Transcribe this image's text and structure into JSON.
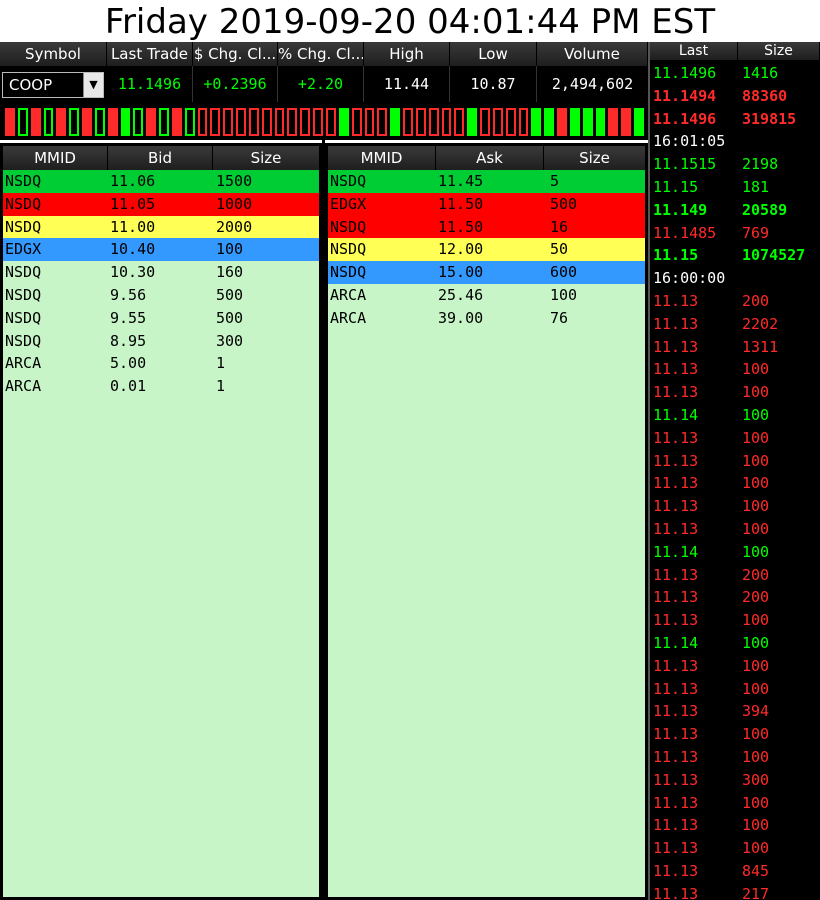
{
  "title": "Friday 2019-09-20 04:01:44 PM EST",
  "colors": {
    "up": "#00ff00",
    "down": "#ff2a2a",
    "level1": "#00cc33",
    "level2": "#ff0000",
    "level3": "#ffff55",
    "level4": "#3399ff",
    "book_bg": "#c8f5c8"
  },
  "quote": {
    "headers": [
      "Symbol",
      "Last Trade",
      "$ Chg. Cl...",
      "% Chg. Cl...",
      "High",
      "Low",
      "Volume"
    ],
    "symbol": "COOP",
    "last_trade": "11.1496",
    "chg": "+0.2396",
    "pct_chg": "+2.20",
    "high": "11.44",
    "low": "10.87",
    "volume": "2,494,602"
  },
  "ticks": [
    {
      "color": "red",
      "filled": true
    },
    {
      "color": "green",
      "filled": false
    },
    {
      "color": "red",
      "filled": true
    },
    {
      "color": "green",
      "filled": false
    },
    {
      "color": "red",
      "filled": true
    },
    {
      "color": "green",
      "filled": false
    },
    {
      "color": "red",
      "filled": true
    },
    {
      "color": "green",
      "filled": false
    },
    {
      "color": "red",
      "filled": true
    },
    {
      "color": "green",
      "filled": true
    },
    {
      "color": "green",
      "filled": false
    },
    {
      "color": "red",
      "filled": true
    },
    {
      "color": "green",
      "filled": false
    },
    {
      "color": "red",
      "filled": true
    },
    {
      "color": "green",
      "filled": false
    },
    {
      "color": "red",
      "filled": false
    },
    {
      "color": "red",
      "filled": false
    },
    {
      "color": "red",
      "filled": false
    },
    {
      "color": "red",
      "filled": false
    },
    {
      "color": "red",
      "filled": false
    },
    {
      "color": "red",
      "filled": false
    },
    {
      "color": "red",
      "filled": false
    },
    {
      "color": "red",
      "filled": false
    },
    {
      "color": "red",
      "filled": false
    },
    {
      "color": "red",
      "filled": false
    },
    {
      "color": "red",
      "filled": false
    },
    {
      "color": "green",
      "filled": true
    },
    {
      "color": "red",
      "filled": false
    },
    {
      "color": "red",
      "filled": false
    },
    {
      "color": "red",
      "filled": false
    },
    {
      "color": "green",
      "filled": true
    },
    {
      "color": "red",
      "filled": false
    },
    {
      "color": "red",
      "filled": false
    },
    {
      "color": "red",
      "filled": false
    },
    {
      "color": "red",
      "filled": false
    },
    {
      "color": "red",
      "filled": false
    },
    {
      "color": "green",
      "filled": true
    },
    {
      "color": "red",
      "filled": false
    },
    {
      "color": "red",
      "filled": false
    },
    {
      "color": "red",
      "filled": false
    },
    {
      "color": "red",
      "filled": false
    },
    {
      "color": "green",
      "filled": true
    },
    {
      "color": "green",
      "filled": true
    },
    {
      "color": "red",
      "filled": true
    },
    {
      "color": "green",
      "filled": true
    },
    {
      "color": "green",
      "filled": true
    },
    {
      "color": "green",
      "filled": true
    },
    {
      "color": "red",
      "filled": true
    },
    {
      "color": "red",
      "filled": true
    },
    {
      "color": "green",
      "filled": true
    }
  ],
  "bid_book": {
    "headers": [
      "MMID",
      "Bid",
      "Size"
    ],
    "rows": [
      {
        "mmid": "NSDQ",
        "price": "11.06",
        "size": "1500",
        "level": 1
      },
      {
        "mmid": "NSDQ",
        "price": "11.05",
        "size": "1000",
        "level": 2
      },
      {
        "mmid": "NSDQ",
        "price": "11.00",
        "size": "2000",
        "level": 3
      },
      {
        "mmid": "EDGX",
        "price": "10.40",
        "size": "100",
        "level": 4
      },
      {
        "mmid": "NSDQ",
        "price": "10.30",
        "size": "160",
        "level": 0
      },
      {
        "mmid": "NSDQ",
        "price": "9.56",
        "size": "500",
        "level": 0
      },
      {
        "mmid": "NSDQ",
        "price": "9.55",
        "size": "500",
        "level": 0
      },
      {
        "mmid": "NSDQ",
        "price": "8.95",
        "size": "300",
        "level": 0
      },
      {
        "mmid": "ARCA",
        "price": "5.00",
        "size": "1",
        "level": 0
      },
      {
        "mmid": "ARCA",
        "price": "0.01",
        "size": "1",
        "level": 0
      }
    ]
  },
  "ask_book": {
    "headers": [
      "MMID",
      "Ask",
      "Size"
    ],
    "rows": [
      {
        "mmid": "NSDQ",
        "price": "11.45",
        "size": "5",
        "level": 1
      },
      {
        "mmid": "EDGX",
        "price": "11.50",
        "size": "500",
        "level": 2
      },
      {
        "mmid": "NSDQ",
        "price": "11.50",
        "size": "16",
        "level": 2
      },
      {
        "mmid": "NSDQ",
        "price": "12.00",
        "size": "50",
        "level": 3
      },
      {
        "mmid": "NSDQ",
        "price": "15.00",
        "size": "600",
        "level": 4
      },
      {
        "mmid": "ARCA",
        "price": "25.46",
        "size": "100",
        "level": 0
      },
      {
        "mmid": "ARCA",
        "price": "39.00",
        "size": "76",
        "level": 0
      }
    ]
  },
  "time_sales": {
    "headers": [
      "Last",
      "Size"
    ],
    "rows": [
      {
        "last": "11.1496",
        "size": "1416",
        "color": "green",
        "bold": false
      },
      {
        "last": "11.1494",
        "size": "88360",
        "color": "red",
        "bold": true
      },
      {
        "last": "11.1496",
        "size": "319815",
        "color": "red",
        "bold": true
      },
      {
        "time": "16:01:05"
      },
      {
        "last": "11.1515",
        "size": "2198",
        "color": "green",
        "bold": false
      },
      {
        "last": "11.15",
        "size": "181",
        "color": "green",
        "bold": false
      },
      {
        "last": "11.149",
        "size": "20589",
        "color": "green",
        "bold": true
      },
      {
        "last": "11.1485",
        "size": "769",
        "color": "red",
        "bold": false
      },
      {
        "last": "11.15",
        "size": "1074527",
        "color": "green",
        "bold": true
      },
      {
        "time": "16:00:00"
      },
      {
        "last": "11.13",
        "size": "200",
        "color": "red",
        "bold": false
      },
      {
        "last": "11.13",
        "size": "2202",
        "color": "red",
        "bold": false
      },
      {
        "last": "11.13",
        "size": "1311",
        "color": "red",
        "bold": false
      },
      {
        "last": "11.13",
        "size": "100",
        "color": "red",
        "bold": false
      },
      {
        "last": "11.13",
        "size": "100",
        "color": "red",
        "bold": false
      },
      {
        "last": "11.14",
        "size": "100",
        "color": "green",
        "bold": false
      },
      {
        "last": "11.13",
        "size": "100",
        "color": "red",
        "bold": false
      },
      {
        "last": "11.13",
        "size": "100",
        "color": "red",
        "bold": false
      },
      {
        "last": "11.13",
        "size": "100",
        "color": "red",
        "bold": false
      },
      {
        "last": "11.13",
        "size": "100",
        "color": "red",
        "bold": false
      },
      {
        "last": "11.13",
        "size": "100",
        "color": "red",
        "bold": false
      },
      {
        "last": "11.14",
        "size": "100",
        "color": "green",
        "bold": false
      },
      {
        "last": "11.13",
        "size": "200",
        "color": "red",
        "bold": false
      },
      {
        "last": "11.13",
        "size": "200",
        "color": "red",
        "bold": false
      },
      {
        "last": "11.13",
        "size": "100",
        "color": "red",
        "bold": false
      },
      {
        "last": "11.14",
        "size": "100",
        "color": "green",
        "bold": false
      },
      {
        "last": "11.13",
        "size": "100",
        "color": "red",
        "bold": false
      },
      {
        "last": "11.13",
        "size": "100",
        "color": "red",
        "bold": false
      },
      {
        "last": "11.13",
        "size": "394",
        "color": "red",
        "bold": false
      },
      {
        "last": "11.13",
        "size": "100",
        "color": "red",
        "bold": false
      },
      {
        "last": "11.13",
        "size": "100",
        "color": "red",
        "bold": false
      },
      {
        "last": "11.13",
        "size": "300",
        "color": "red",
        "bold": false
      },
      {
        "last": "11.13",
        "size": "100",
        "color": "red",
        "bold": false
      },
      {
        "last": "11.13",
        "size": "100",
        "color": "red",
        "bold": false
      },
      {
        "last": "11.13",
        "size": "100",
        "color": "red",
        "bold": false
      },
      {
        "last": "11.13",
        "size": "845",
        "color": "red",
        "bold": false
      },
      {
        "last": "11.13",
        "size": "217",
        "color": "red",
        "bold": false
      }
    ]
  }
}
